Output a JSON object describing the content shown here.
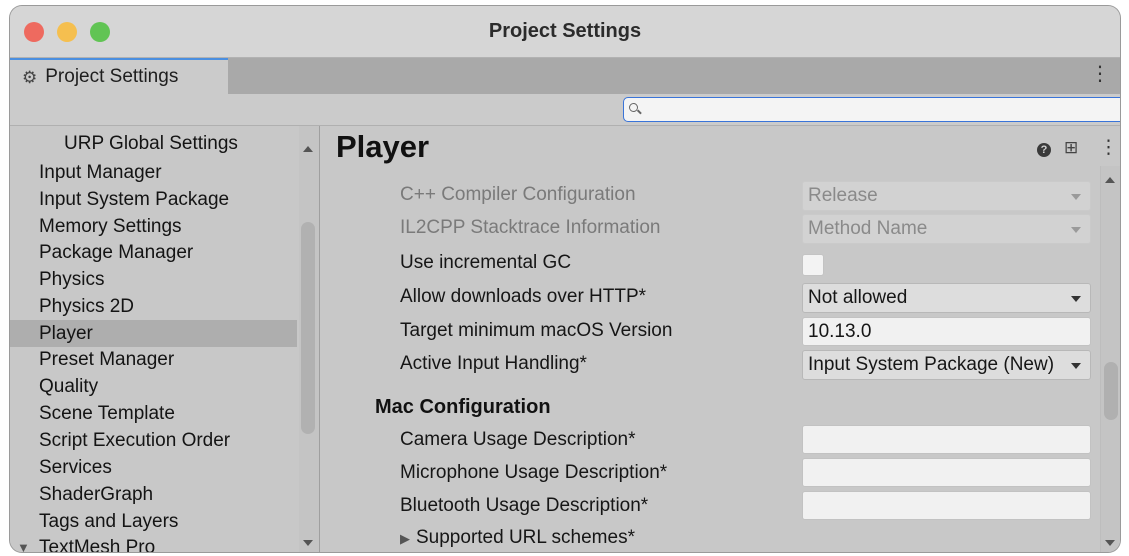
{
  "window": {
    "title": "Project Settings"
  },
  "tab": {
    "label": "Project Settings",
    "icon": "gear-icon"
  },
  "search": {
    "placeholder": "",
    "value": ""
  },
  "sidebar": {
    "items": [
      {
        "label": "URP Global Settings"
      },
      {
        "label": "Input Manager"
      },
      {
        "label": "Input System Package"
      },
      {
        "label": "Memory Settings"
      },
      {
        "label": "Package Manager"
      },
      {
        "label": "Physics"
      },
      {
        "label": "Physics 2D"
      },
      {
        "label": "Player",
        "selected": true
      },
      {
        "label": "Preset Manager"
      },
      {
        "label": "Quality"
      },
      {
        "label": "Scene Template"
      },
      {
        "label": "Script Execution Order"
      },
      {
        "label": "Services"
      },
      {
        "label": "ShaderGraph"
      },
      {
        "label": "Tags and Layers"
      },
      {
        "label": "TextMesh Pro",
        "expandable": true
      }
    ]
  },
  "main": {
    "title": "Player",
    "settings": [
      {
        "label": "C++ Compiler Configuration",
        "control": "dropdown",
        "value": "Release",
        "disabled": true
      },
      {
        "label": "IL2CPP Stacktrace Information",
        "control": "dropdown",
        "value": "Method Name",
        "disabled": true
      },
      {
        "label": "Use incremental GC",
        "control": "checkbox",
        "checked": false
      },
      {
        "label": "Allow downloads over HTTP*",
        "control": "dropdown",
        "value": "Not allowed"
      },
      {
        "label": "Target minimum macOS Version",
        "control": "text",
        "value": "10.13.0"
      },
      {
        "label": "Active Input Handling*",
        "control": "dropdown",
        "value": "Input System Package (New)"
      }
    ],
    "mac_section": {
      "title": "Mac Configuration",
      "fields": [
        {
          "label": "Camera Usage Description*",
          "value": ""
        },
        {
          "label": "Microphone Usage Description*",
          "value": ""
        },
        {
          "label": "Bluetooth Usage Description*",
          "value": ""
        }
      ],
      "foldout": "Supported URL schemes*"
    }
  },
  "colors": {
    "selection": "#aeaeae",
    "accent": "#3a74d8",
    "panel": "#c8c8c8"
  }
}
